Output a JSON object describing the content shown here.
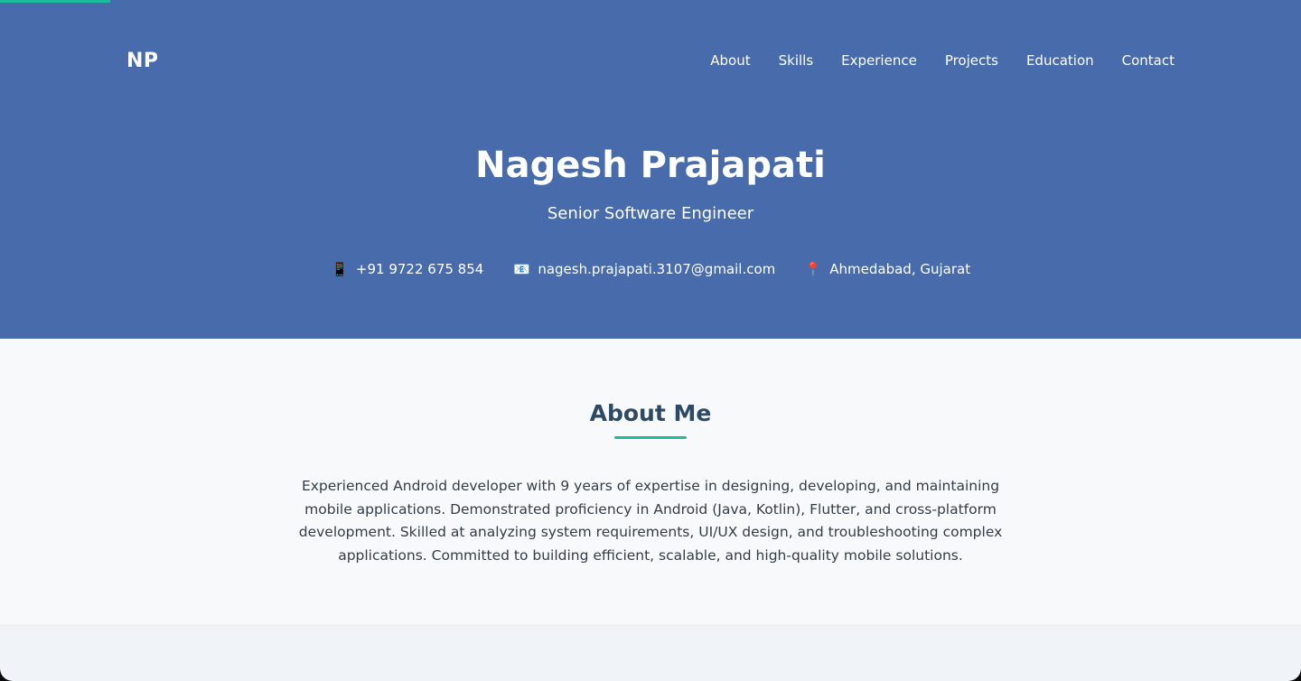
{
  "page": {
    "scroll_progress_percent": 8.5
  },
  "nav": {
    "logo": "NP",
    "links": [
      "About",
      "Skills",
      "Experience",
      "Projects",
      "Education",
      "Contact"
    ]
  },
  "hero": {
    "name": "Nagesh Prajapati",
    "title": "Senior Software Engineer",
    "contacts": {
      "phone": {
        "icon": "mobile-phone-icon",
        "glyph": "📱",
        "text": "+91 9722 675 854"
      },
      "email": {
        "icon": "email-icon",
        "glyph": "📧",
        "text": "nagesh.prajapati.3107@gmail.com"
      },
      "location": {
        "icon": "location-pin-icon",
        "glyph": "📍",
        "text": "Ahmedabad, Gujarat"
      }
    }
  },
  "about": {
    "heading": "About Me",
    "body": "Experienced Android developer with 9 years of expertise in designing, developing, and maintaining mobile applications. Demonstrated proficiency in Android (Java, Kotlin), Flutter, and cross-platform development. Skilled at analyzing system requirements, UI/UX design, and troubleshooting complex applications. Committed to building efficient, scalable, and high-quality mobile solutions."
  },
  "colors": {
    "hero_background": "#476bab",
    "accent": "#1abc9c",
    "heading": "#2c4a66",
    "section_background": "#f7f9fb",
    "page_background": "#f0f4f8"
  }
}
